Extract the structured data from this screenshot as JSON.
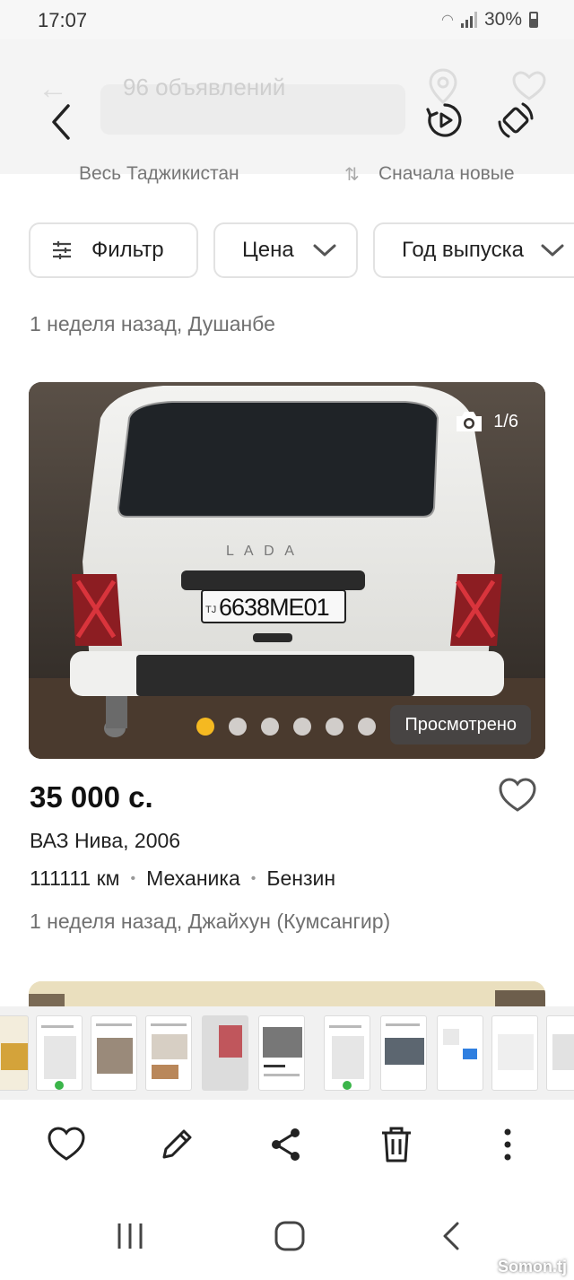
{
  "status_bar": {
    "time": "17:07",
    "battery": "30%"
  },
  "background_header": {
    "search_placeholder": "96 объявлений"
  },
  "location_row": {
    "region": "Весь Таджикистан",
    "sort": "Сначала новые"
  },
  "filters": [
    {
      "label": "Фильтр",
      "icon": "sliders-icon"
    },
    {
      "label": "Цена",
      "icon": "chevron-down-icon"
    },
    {
      "label": "Год выпуска",
      "icon": "chevron-down-icon"
    }
  ],
  "previous_listing": {
    "meta": "1 неделя назад, Душанбе"
  },
  "listing": {
    "photo_counter": "1/6",
    "photo_count": 6,
    "active_photo": 1,
    "viewed_label": "Просмотрено",
    "plate": {
      "country": "TJ",
      "number": "6638МЕ01"
    },
    "car_badge": "L A D A",
    "price": "35 000 с.",
    "title": "ВАЗ Нива, 2006",
    "specs": [
      "111111 км",
      "Механика",
      "Бензин"
    ],
    "meta": "1 неделя назад, Джайхун (Кумсангир)"
  },
  "bottom_actions": [
    "heart-icon",
    "pencil-icon",
    "share-icon",
    "trash-icon",
    "more-vertical-icon"
  ],
  "system_nav": [
    "recent-apps-icon",
    "home-icon",
    "back-icon"
  ],
  "watermark": "Somon.tj",
  "colors": {
    "accent_dot": "#f5b921",
    "text_muted": "#707070"
  }
}
